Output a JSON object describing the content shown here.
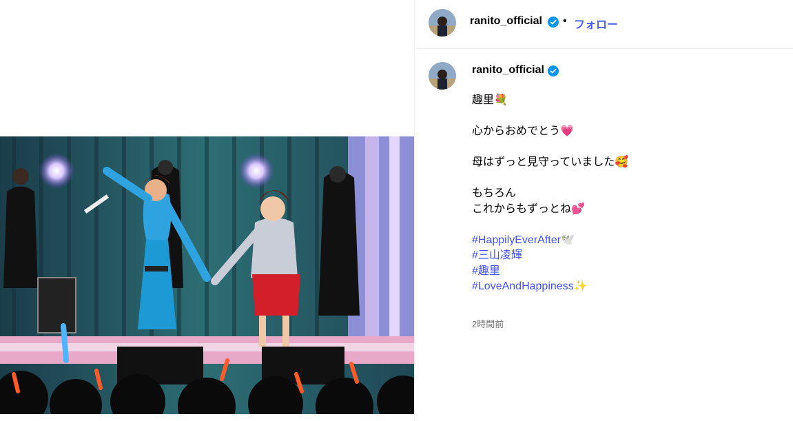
{
  "post": {
    "username": "ranito_official",
    "separator": "•",
    "follow_label": "フォロー",
    "caption_lines": {
      "l1": "趣里💐",
      "l2": "心からおめでとう💗",
      "l3": "母はずっと見守っていました🥰",
      "l4": "もちろん",
      "l5": "これからもずっとね💕"
    },
    "hashtags": [
      "#HappilyEverAfter🕊️",
      "#三山凌輝",
      "#趣里",
      "#LoveAndHappiness✨"
    ],
    "timestamp": "2時間前"
  },
  "colors": {
    "link_blue": "#4150f7",
    "verified_blue": "#0095f6",
    "muted_gray": "#737373"
  },
  "icons": {
    "verified": "verified-badge-icon"
  }
}
